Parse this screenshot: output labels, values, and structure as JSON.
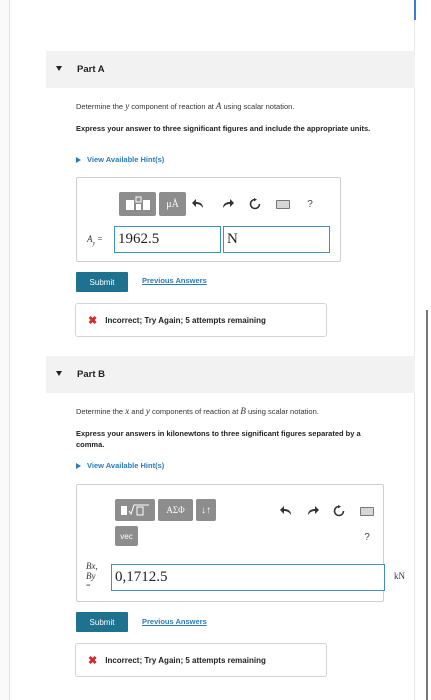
{
  "partA": {
    "title": "Part A",
    "question_pre": "Determine the ",
    "question_var1": "y",
    "question_mid": " component of reaction at ",
    "question_var2": "A",
    "question_post": " using scalar notation.",
    "instructions": "Express your answer to three significant figures and include the appropriate units.",
    "hint": "View Available Hint(s)",
    "toolbar": {
      "units_btn": "μÅ",
      "help": "?"
    },
    "label_var": "A",
    "label_sub": "y",
    "label_eq": " =",
    "value": "1962.5",
    "units_value": "N",
    "submit": "Submit",
    "previous": "Previous Answers",
    "feedback": "Incorrect; Try Again; 5 attempts remaining"
  },
  "partB": {
    "title": "Part B",
    "question_pre": "Determine the ",
    "question_var1": "x",
    "question_mid": " and ",
    "question_var2": "y",
    "question_mid2": " components of reaction at ",
    "question_var3": "B",
    "question_post": " using scalar notation.",
    "instructions": "Express your answers in kilonewtons to three significant figures separated by a comma.",
    "hint": "View Available Hint(s)",
    "toolbar": {
      "greek_btn": "ΑΣΦ",
      "vec_btn": "vec",
      "help": "?"
    },
    "label_line1": "Bx,",
    "label_line2": "By",
    "label_eq": "=",
    "value": "0,1712.5",
    "units": "kN",
    "submit": "Submit",
    "previous": "Previous Answers",
    "feedback": "Incorrect; Try Again; 5 attempts remaining"
  }
}
